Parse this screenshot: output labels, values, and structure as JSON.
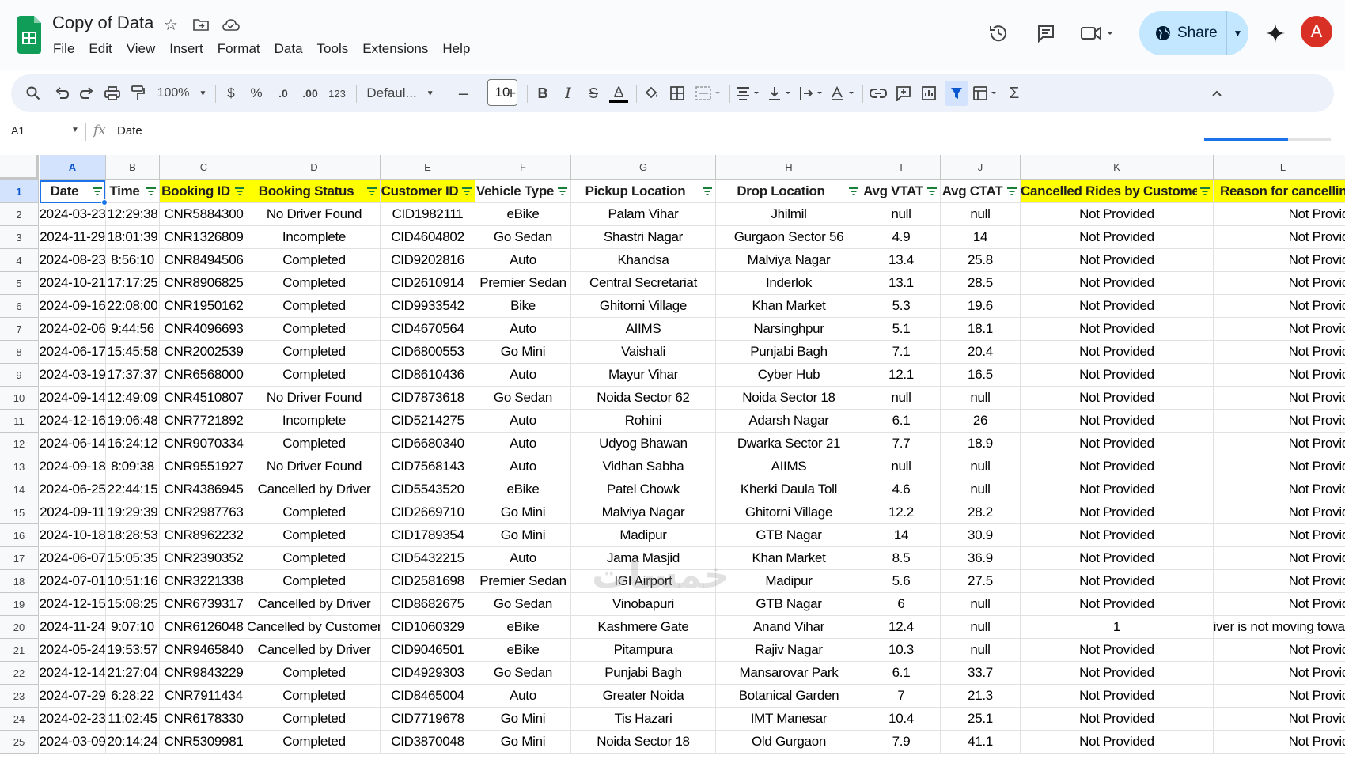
{
  "app": {
    "doc_title": "Copy of Data",
    "menu": [
      "File",
      "Edit",
      "View",
      "Insert",
      "Format",
      "Data",
      "Tools",
      "Extensions",
      "Help"
    ],
    "share_label": "Share",
    "avatar_letter": "A",
    "accent_color": "#1a73e8",
    "share_color": "#c2e7ff",
    "avatar_color": "#d93025"
  },
  "toolbar": {
    "zoom": "100%",
    "currency": "$",
    "percent": "%",
    "dec_decrease": ".0",
    "dec_increase": ".00",
    "format_123": "123",
    "font_family": "Defaul...",
    "font_size": "10",
    "minus": "–",
    "plus": "+",
    "bold": "B",
    "italic": "I",
    "strike": "S",
    "text_color": "A",
    "text_color_hex": "#000000",
    "sum": "Σ"
  },
  "formula_bar": {
    "cell_ref": "A1",
    "fx": "fx",
    "value": "Date",
    "load_progress": 0.66
  },
  "sheet": {
    "columns": [
      "A",
      "B",
      "C",
      "D",
      "E",
      "F",
      "G",
      "H",
      "I",
      "J",
      "K",
      "L"
    ],
    "headers": [
      "Date",
      "Time",
      "Booking ID",
      "Booking Status",
      "Customer ID",
      "Vehicle Type",
      "Pickup Location",
      "Drop Location",
      "Avg VTAT",
      "Avg CTAT",
      "Cancelled Rides by Customer",
      "Reason for cancelling b"
    ],
    "header_highlight": [
      "white",
      "white",
      "yellow",
      "yellow",
      "yellow",
      "white",
      "white",
      "white",
      "white",
      "white",
      "yellow",
      "yellow"
    ],
    "highlight_color": "#ffff00",
    "rows": [
      [
        "2024-03-23",
        "12:29:38",
        "CNR5884300",
        "No Driver Found",
        "CID1982111",
        "eBike",
        "Palam Vihar",
        "Jhilmil",
        "null",
        "null",
        "Not Provided",
        "Not Provid"
      ],
      [
        "2024-11-29",
        "18:01:39",
        "CNR1326809",
        "Incomplete",
        "CID4604802",
        "Go Sedan",
        "Shastri Nagar",
        "Gurgaon Sector 56",
        "4.9",
        "14",
        "Not Provided",
        "Not Provid"
      ],
      [
        "2024-08-23",
        "8:56:10",
        "CNR8494506",
        "Completed",
        "CID9202816",
        "Auto",
        "Khandsa",
        "Malviya Nagar",
        "13.4",
        "25.8",
        "Not Provided",
        "Not Provid"
      ],
      [
        "2024-10-21",
        "17:17:25",
        "CNR8906825",
        "Completed",
        "CID2610914",
        "Premier Sedan",
        "Central Secretariat",
        "Inderlok",
        "13.1",
        "28.5",
        "Not Provided",
        "Not Provid"
      ],
      [
        "2024-09-16",
        "22:08:00",
        "CNR1950162",
        "Completed",
        "CID9933542",
        "Bike",
        "Ghitorni Village",
        "Khan Market",
        "5.3",
        "19.6",
        "Not Provided",
        "Not Provid"
      ],
      [
        "2024-02-06",
        "9:44:56",
        "CNR4096693",
        "Completed",
        "CID4670564",
        "Auto",
        "AIIMS",
        "Narsinghpur",
        "5.1",
        "18.1",
        "Not Provided",
        "Not Provid"
      ],
      [
        "2024-06-17",
        "15:45:58",
        "CNR2002539",
        "Completed",
        "CID6800553",
        "Go Mini",
        "Vaishali",
        "Punjabi Bagh",
        "7.1",
        "20.4",
        "Not Provided",
        "Not Provid"
      ],
      [
        "2024-03-19",
        "17:37:37",
        "CNR6568000",
        "Completed",
        "CID8610436",
        "Auto",
        "Mayur Vihar",
        "Cyber Hub",
        "12.1",
        "16.5",
        "Not Provided",
        "Not Provid"
      ],
      [
        "2024-09-14",
        "12:49:09",
        "CNR4510807",
        "No Driver Found",
        "CID7873618",
        "Go Sedan",
        "Noida Sector 62",
        "Noida Sector 18",
        "null",
        "null",
        "Not Provided",
        "Not Provid"
      ],
      [
        "2024-12-16",
        "19:06:48",
        "CNR7721892",
        "Incomplete",
        "CID5214275",
        "Auto",
        "Rohini",
        "Adarsh Nagar",
        "6.1",
        "26",
        "Not Provided",
        "Not Provid"
      ],
      [
        "2024-06-14",
        "16:24:12",
        "CNR9070334",
        "Completed",
        "CID6680340",
        "Auto",
        "Udyog Bhawan",
        "Dwarka Sector 21",
        "7.7",
        "18.9",
        "Not Provided",
        "Not Provid"
      ],
      [
        "2024-09-18",
        "8:09:38",
        "CNR9551927",
        "No Driver Found",
        "CID7568143",
        "Auto",
        "Vidhan Sabha",
        "AIIMS",
        "null",
        "null",
        "Not Provided",
        "Not Provid"
      ],
      [
        "2024-06-25",
        "22:44:15",
        "CNR4386945",
        "Cancelled by Driver",
        "CID5543520",
        "eBike",
        "Patel Chowk",
        "Kherki Daula Toll",
        "4.6",
        "null",
        "Not Provided",
        "Not Provid"
      ],
      [
        "2024-09-11",
        "19:29:39",
        "CNR2987763",
        "Completed",
        "CID2669710",
        "Go Mini",
        "Malviya Nagar",
        "Ghitorni Village",
        "12.2",
        "28.2",
        "Not Provided",
        "Not Provid"
      ],
      [
        "2024-10-18",
        "18:28:53",
        "CNR8962232",
        "Completed",
        "CID1789354",
        "Go Mini",
        "Madipur",
        "GTB Nagar",
        "14",
        "30.9",
        "Not Provided",
        "Not Provid"
      ],
      [
        "2024-06-07",
        "15:05:35",
        "CNR2390352",
        "Completed",
        "CID5432215",
        "Auto",
        "Jama Masjid",
        "Khan Market",
        "8.5",
        "36.9",
        "Not Provided",
        "Not Provid"
      ],
      [
        "2024-07-01",
        "10:51:16",
        "CNR3221338",
        "Completed",
        "CID2581698",
        "Premier Sedan",
        "IGI Airport",
        "Madipur",
        "5.6",
        "27.5",
        "Not Provided",
        "Not Provid"
      ],
      [
        "2024-12-15",
        "15:08:25",
        "CNR6739317",
        "Cancelled by Driver",
        "CID8682675",
        "Go Sedan",
        "Vinobapuri",
        "GTB Nagar",
        "6",
        "null",
        "Not Provided",
        "Not Provid"
      ],
      [
        "2024-11-24",
        "9:07:10",
        "CNR6126048",
        "Cancelled by Customer",
        "CID1060329",
        "eBike",
        "Kashmere Gate",
        "Anand Vihar",
        "12.4",
        "null",
        "1",
        "Driver is not moving towar"
      ],
      [
        "2024-05-24",
        "19:53:57",
        "CNR9465840",
        "Cancelled by Driver",
        "CID9046501",
        "eBike",
        "Pitampura",
        "Rajiv Nagar",
        "10.3",
        "null",
        "Not Provided",
        "Not Provid"
      ],
      [
        "2024-12-14",
        "21:27:04",
        "CNR9843229",
        "Completed",
        "CID4929303",
        "Go Sedan",
        "Punjabi Bagh",
        "Mansarovar Park",
        "6.1",
        "33.7",
        "Not Provided",
        "Not Provid"
      ],
      [
        "2024-07-29",
        "6:28:22",
        "CNR7911434",
        "Completed",
        "CID8465004",
        "Auto",
        "Greater Noida",
        "Botanical Garden",
        "7",
        "21.3",
        "Not Provided",
        "Not Provid"
      ],
      [
        "2024-02-23",
        "11:02:45",
        "CNR6178330",
        "Completed",
        "CID7719678",
        "Go Mini",
        "Tis Hazari",
        "IMT Manesar",
        "10.4",
        "25.1",
        "Not Provided",
        "Not Provid"
      ],
      [
        "2024-03-09",
        "20:14:24",
        "CNR5309981",
        "Completed",
        "CID3870048",
        "Go Mini",
        "Noida Sector 18",
        "Old Gurgaon",
        "7.9",
        "41.1",
        "Not Provided",
        "Not Provid"
      ]
    ]
  }
}
